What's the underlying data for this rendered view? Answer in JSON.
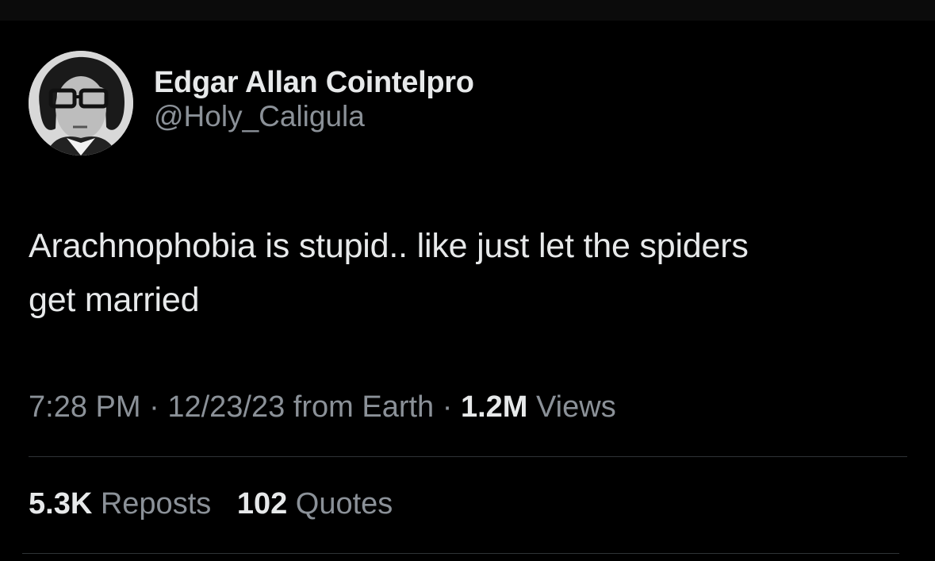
{
  "author": {
    "display_name": "Edgar Allan Cointelpro",
    "handle": "@Holy_Caligula",
    "avatar_icon": "profile-photo"
  },
  "tweet": {
    "text_line1": "Arachnophobia is stupid.. like just let the spiders",
    "text_line2": "get married"
  },
  "meta": {
    "time": "7:28 PM",
    "separator": "·",
    "date": "12/23/23",
    "source": "from Earth",
    "views_count": "1.2M",
    "views_label": "Views"
  },
  "stats": {
    "reposts_count": "5.3K",
    "reposts_label": "Reposts",
    "quotes_count": "102",
    "quotes_label": "Quotes"
  },
  "colors": {
    "background": "#000000",
    "primary_text": "#e7e9ea",
    "secondary_text": "#8b9198",
    "divider": "#2f3336"
  }
}
